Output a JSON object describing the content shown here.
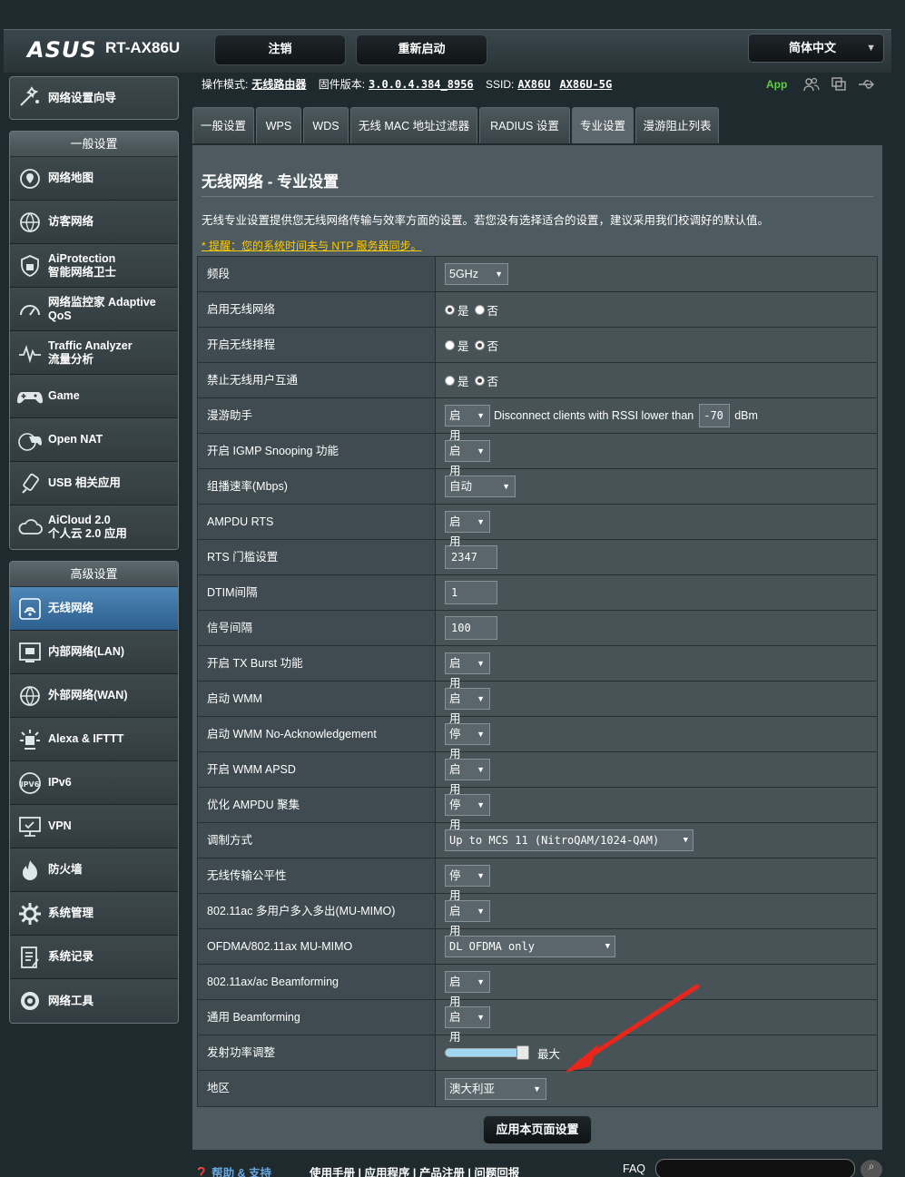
{
  "header": {
    "brand": "ASUS",
    "model": "RT-AX86U",
    "logout_label": "注销",
    "reboot_label": "重新启动",
    "language": "简体中文"
  },
  "info": {
    "mode_label": "操作模式:",
    "mode_value": "无线路由器",
    "fw_label": "固件版本:",
    "fw_value": "3.0.0.4.384_8956",
    "ssid_label": "SSID:",
    "ssid_1": "AX86U",
    "ssid_2": "AX86U-5G",
    "app_label": "App"
  },
  "sidebar": {
    "wizard": "网络设置向导",
    "general_head": "一般设置",
    "general": [
      {
        "label": "网络地图",
        "icon": "map-icon"
      },
      {
        "label": "访客网络",
        "icon": "guest-network-icon"
      },
      {
        "label": "AiProtection",
        "label2": "智能网络卫士",
        "icon": "shield-icon"
      },
      {
        "label": "网络监控家 Adaptive",
        "label2": "QoS",
        "icon": "gauge-icon"
      },
      {
        "label": "Traffic Analyzer",
        "label2": "流量分析",
        "icon": "traffic-icon"
      },
      {
        "label": "Game",
        "icon": "gamepad-icon"
      },
      {
        "label": "Open NAT",
        "icon": "open-nat-icon"
      },
      {
        "label": "USB 相关应用",
        "icon": "usb-icon"
      },
      {
        "label": "AiCloud 2.0",
        "label2": "个人云 2.0 应用",
        "icon": "cloud-icon"
      }
    ],
    "advanced_head": "高级设置",
    "advanced": [
      {
        "label": "无线网络",
        "icon": "wifi-icon"
      },
      {
        "label": "内部网络(LAN)",
        "icon": "lan-icon"
      },
      {
        "label": "外部网络(WAN)",
        "icon": "wan-icon"
      },
      {
        "label": "Alexa & IFTTT",
        "icon": "alexa-icon"
      },
      {
        "label": "IPv6",
        "icon": "ipv6-icon"
      },
      {
        "label": "VPN",
        "icon": "vpn-icon"
      },
      {
        "label": "防火墙",
        "icon": "firewall-icon"
      },
      {
        "label": "系统管理",
        "icon": "gear-icon"
      },
      {
        "label": "系统记录",
        "icon": "log-icon"
      },
      {
        "label": "网络工具",
        "icon": "tools-icon"
      }
    ]
  },
  "tabs": [
    "一般设置",
    "WPS",
    "WDS",
    "无线 MAC 地址过滤器",
    "RADIUS 设置",
    "专业设置",
    "漫游阻止列表"
  ],
  "page": {
    "title": "无线网络 - 专业设置",
    "desc": "无线专业设置提供您无线网络传输与效率方面的设置。若您没有选择适合的设置，建议采用我们校调好的默认值。",
    "warning": "* 提醒：您的系统时间未与 NTP 服务器同步。",
    "apply_label": "应用本页面设置"
  },
  "rows": [
    {
      "label": "频段",
      "type": "select",
      "value": "5GHz"
    },
    {
      "label": "启用无线网络",
      "type": "radio",
      "yes": "是",
      "no": "否",
      "selected": "yes"
    },
    {
      "label": "开启无线排程",
      "type": "radio",
      "yes": "是",
      "no": "否",
      "selected": "no"
    },
    {
      "label": "禁止无线用户互通",
      "type": "radio",
      "yes": "是",
      "no": "否",
      "selected": "no"
    },
    {
      "label": "漫游助手",
      "type": "roam",
      "value": "启用",
      "text": "Disconnect clients with RSSI lower than",
      "rssi": "-70",
      "unit": "dBm"
    },
    {
      "label": "开启 IGMP Snooping 功能",
      "type": "select",
      "value": "启用"
    },
    {
      "label": "组播速率(Mbps)",
      "type": "select",
      "value": "自动"
    },
    {
      "label": "AMPDU RTS",
      "type": "select",
      "value": "启用"
    },
    {
      "label": "RTS 门槛设置",
      "type": "input",
      "value": "2347"
    },
    {
      "label": "DTIM间隔",
      "type": "input",
      "value": "1"
    },
    {
      "label": "信号间隔",
      "type": "input",
      "value": "100"
    },
    {
      "label": "开启 TX Burst 功能",
      "type": "select",
      "value": "启用"
    },
    {
      "label": "启动 WMM",
      "type": "select",
      "value": "启用"
    },
    {
      "label": "启动 WMM No-Acknowledgement",
      "type": "select",
      "value": "停用"
    },
    {
      "label": "开启 WMM APSD",
      "type": "select",
      "value": "启用"
    },
    {
      "label": "优化 AMPDU 聚集",
      "type": "select",
      "value": "停用"
    },
    {
      "label": "调制方式",
      "type": "select",
      "value": "Up to MCS 11 (NitroQAM/1024-QAM)"
    },
    {
      "label": "无线传输公平性",
      "type": "select",
      "value": "停用"
    },
    {
      "label": "802.11ac 多用户多入多出(MU-MIMO)",
      "type": "select",
      "value": "启用"
    },
    {
      "label": "OFDMA/802.11ax MU-MIMO",
      "type": "select",
      "value": "DL OFDMA only"
    },
    {
      "label": "802.11ax/ac Beamforming",
      "type": "select",
      "value": "启用"
    },
    {
      "label": "通用 Beamforming",
      "type": "select",
      "value": "启用"
    },
    {
      "label": "发射功率调整",
      "type": "slider",
      "value": "最大",
      "level": 1.0
    },
    {
      "label": "地区",
      "type": "select",
      "value": "澳大利亚"
    }
  ],
  "footer": {
    "help": "帮助 & 支持",
    "links": "使用手册 | 应用程序 | 产品注册 | 问题回报",
    "faq": "FAQ"
  },
  "colors": {
    "annotation_arrow": "#e8261c",
    "active_menu": "#3a75a8",
    "app_green": "#5fce3c",
    "warning": "#ffcc00"
  }
}
